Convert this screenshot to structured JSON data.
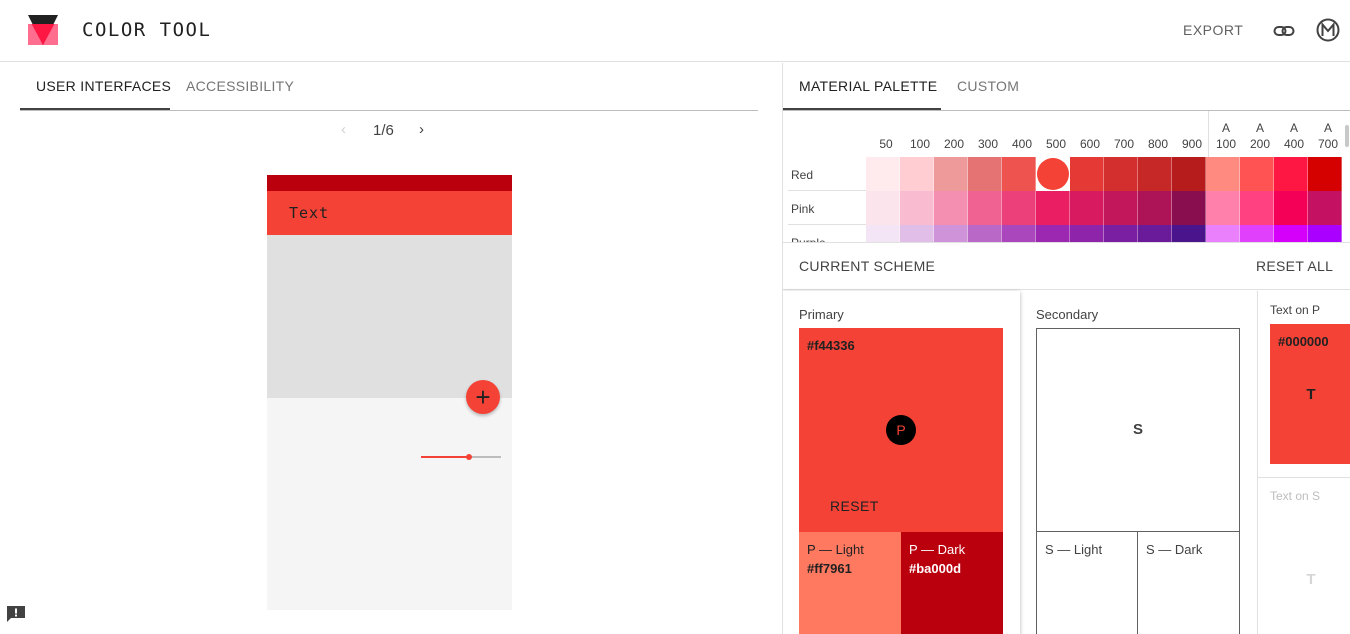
{
  "app": {
    "title": "COLOR TOOL",
    "export_label": "EXPORT",
    "icons": {
      "logo": "color-tool-logo",
      "link": "link-icon",
      "material": "material-m-icon",
      "feedback": "feedback-icon"
    }
  },
  "left": {
    "tabs": [
      {
        "label": "USER INTERFACES",
        "active": true
      },
      {
        "label": "ACCESSIBILITY",
        "active": false
      }
    ],
    "pager": {
      "prev": "‹",
      "label": "1/6",
      "next": "›"
    },
    "preview": {
      "toolbar_text": "Text",
      "fab_label": "+",
      "slider_value": 0.6,
      "colors": {
        "status": "#ba000d",
        "toolbar": "#f44336",
        "image": "#e0e0e0",
        "surface": "#f5f5f5",
        "fab": "#f44336"
      }
    }
  },
  "right": {
    "tabs": [
      {
        "label": "MATERIAL PALETTE",
        "active": true
      },
      {
        "label": "CUSTOM",
        "active": false
      }
    ],
    "palette": {
      "shades": [
        {
          "l1": "",
          "l2": "50"
        },
        {
          "l1": "",
          "l2": "100"
        },
        {
          "l1": "",
          "l2": "200"
        },
        {
          "l1": "",
          "l2": "300"
        },
        {
          "l1": "",
          "l2": "400"
        },
        {
          "l1": "",
          "l2": "500"
        },
        {
          "l1": "",
          "l2": "600"
        },
        {
          "l1": "",
          "l2": "700"
        },
        {
          "l1": "",
          "l2": "800"
        },
        {
          "l1": "",
          "l2": "900"
        },
        {
          "l1": "A",
          "l2": "100"
        },
        {
          "l1": "A",
          "l2": "200"
        },
        {
          "l1": "A",
          "l2": "400"
        },
        {
          "l1": "A",
          "l2": "700"
        }
      ],
      "hues": [
        {
          "name": "Red",
          "colors": [
            "#ffebee",
            "#ffcdd2",
            "#ef9a9a",
            "#e57373",
            "#ef5350",
            "#f44336",
            "#e53935",
            "#d32f2f",
            "#c62828",
            "#b71c1c",
            "#ff8a80",
            "#ff5252",
            "#ff1744",
            "#d50000"
          ]
        },
        {
          "name": "Pink",
          "colors": [
            "#fce4ec",
            "#f8bbd0",
            "#f48fb1",
            "#f06292",
            "#ec407a",
            "#e91e63",
            "#d81b60",
            "#c2185b",
            "#ad1457",
            "#880e4f",
            "#ff80ab",
            "#ff4081",
            "#f50057",
            "#c51162"
          ]
        },
        {
          "name": "Purple",
          "colors": [
            "#f3e5f5",
            "#e1bee7",
            "#ce93d8",
            "#ba68c8",
            "#ab47bc",
            "#9c27b0",
            "#8e24aa",
            "#7b1fa2",
            "#6a1b9a",
            "#4a148c",
            "#ea80fc",
            "#e040fb",
            "#d500f9",
            "#aa00ff"
          ]
        }
      ],
      "selected": {
        "hue": 0,
        "shade": 5
      }
    },
    "scheme": {
      "title": "CURRENT SCHEME",
      "reset_all": "RESET ALL",
      "primary": {
        "label": "Primary",
        "hex": "#f44336",
        "badge": "P",
        "reset": "RESET",
        "light_label": "P — Light",
        "light_hex": "#ff7961",
        "dark_label": "P — Dark",
        "dark_hex": "#ba000d"
      },
      "secondary": {
        "label": "Secondary",
        "letter": "S",
        "light_label": "S — Light",
        "dark_label": "S — Dark"
      },
      "text_on_p": {
        "label": "Text on P",
        "hex": "#000000",
        "letter": "T"
      },
      "text_on_s": {
        "label": "Text on S",
        "letter": "T"
      }
    }
  }
}
